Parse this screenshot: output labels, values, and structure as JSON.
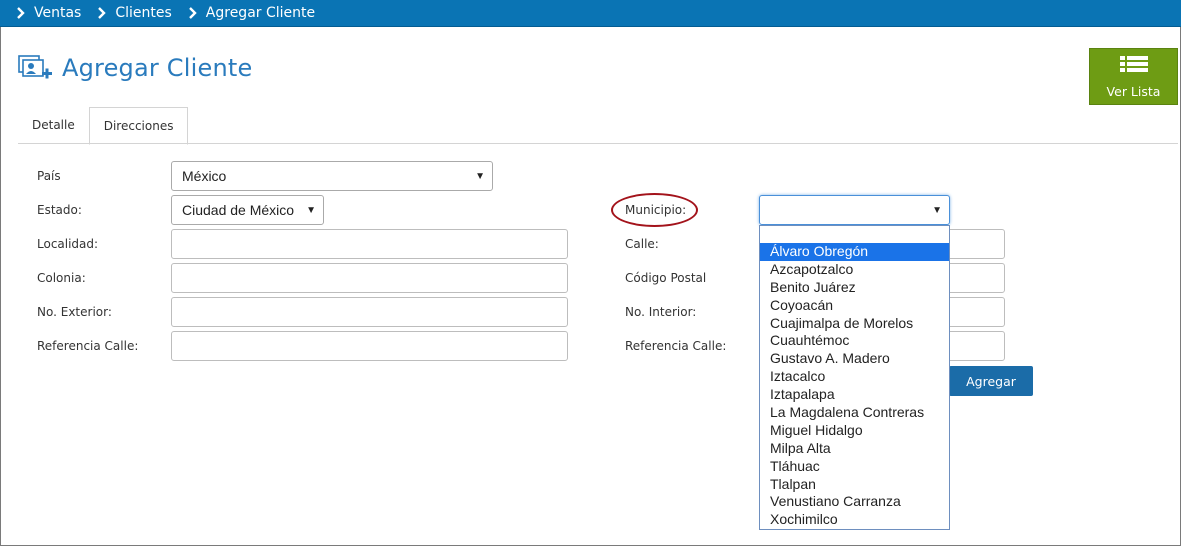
{
  "breadcrumb": {
    "items": [
      "Ventas",
      "Clientes",
      "Agregar Cliente"
    ]
  },
  "header": {
    "title": "Agregar Cliente",
    "icon": "add-client-icon"
  },
  "actions": {
    "ver_lista_label": "Ver Lista",
    "agregar_label": "Agregar"
  },
  "tabs": [
    {
      "label": "Detalle",
      "active": false
    },
    {
      "label": "Direcciones",
      "active": true
    }
  ],
  "form": {
    "pais": {
      "label": "País",
      "value": "México"
    },
    "estado": {
      "label": "Estado:",
      "value": "Ciudad de México"
    },
    "localidad": {
      "label": "Localidad:",
      "value": ""
    },
    "colonia": {
      "label": "Colonia:",
      "value": ""
    },
    "no_exterior": {
      "label": "No. Exterior:",
      "value": ""
    },
    "referencia_calle_1": {
      "label": "Referencia Calle:",
      "value": ""
    },
    "municipio": {
      "label": "Municipio:",
      "value": ""
    },
    "calle": {
      "label": "Calle:",
      "value": ""
    },
    "codigo_postal": {
      "label": "Código Postal",
      "value": ""
    },
    "no_interior": {
      "label": "No. Interior:",
      "value": ""
    },
    "referencia_calle_2": {
      "label": "Referencia Calle:",
      "value": ""
    }
  },
  "municipio_options": [
    "Álvaro Obregón",
    "Azcapotzalco",
    "Benito Juárez",
    "Coyoacán",
    "Cuajimalpa de Morelos",
    "Cuauhtémoc",
    "Gustavo A. Madero",
    "Iztacalco",
    "Iztapalapa",
    "La Magdalena Contreras",
    "Miguel Hidalgo",
    "Milpa Alta",
    "Tláhuac",
    "Tlalpan",
    "Venustiano Carranza",
    "Xochimilco"
  ],
  "municipio_highlighted_index": 0,
  "colors": {
    "breadcrumb_bg": "#0a74b4",
    "title": "#2a7bbd",
    "ver_lista_bg": "#6e9c14",
    "agregar_bg": "#1b6ca8",
    "highlight_ring": "#a3131b",
    "selected_option": "#1a73e8"
  }
}
